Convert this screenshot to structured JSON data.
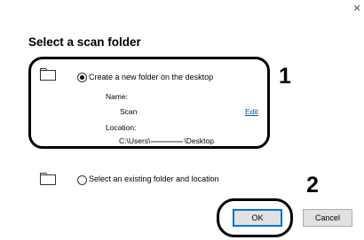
{
  "dialog": {
    "close_glyph": "✕",
    "title": "Select a scan folder",
    "option_new": {
      "label": "Create a new folder on the desktop",
      "checked": true,
      "name_label": "Name:",
      "name_value": "Scan",
      "edit_label": "Edit",
      "location_label": "Location:",
      "location_prefix": "C:\\Users\\",
      "location_suffix": "\\Desktop",
      "icon": "folder-icon"
    },
    "option_existing": {
      "label": "Select an existing folder and location",
      "checked": false,
      "icon": "folder-icon"
    },
    "buttons": {
      "ok": "OK",
      "cancel": "Cancel"
    }
  },
  "callouts": {
    "step1": "1",
    "step2": "2"
  },
  "colors": {
    "link": "#0055cc",
    "ok_border": "#0078d7",
    "button_bg": "#e1e1e1"
  }
}
